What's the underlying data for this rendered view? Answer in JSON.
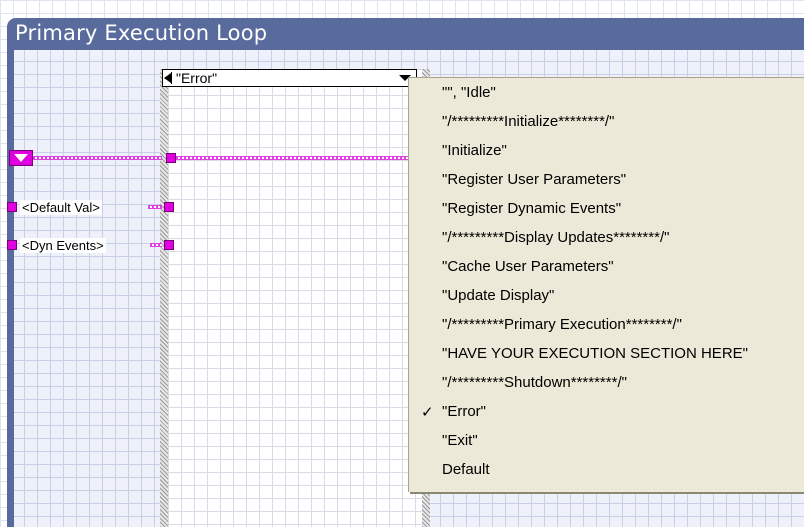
{
  "loop": {
    "title": "Primary Execution Loop"
  },
  "case_selector": {
    "value": "\"Error\""
  },
  "constants": {
    "default_val": "<Default Val>",
    "dyn_events": "<Dyn Events>"
  },
  "menu": {
    "checked_index": 12,
    "check_mark": "✓",
    "items": [
      "\"\", \"Idle\"",
      "\"/*********Initialize********/\"",
      "\"Initialize\"",
      "\"Register User Parameters\"",
      "\"Register Dynamic Events\"",
      "\"/*********Display Updates********/\"",
      "\"Cache User Parameters\"",
      "\"Update Display\"",
      "\"/*********Primary Execution********/\"",
      "\"HAVE YOUR EXECUTION SECTION HERE\"",
      "\"/*********Shutdown********/\"",
      "\"Exit\"",
      "\"Error\"",
      "\"Exit\"",
      "Default"
    ]
  },
  "colors": {
    "frame": "#596a9c",
    "wire": "#e040e0",
    "menu_bg": "#ece9d8"
  }
}
